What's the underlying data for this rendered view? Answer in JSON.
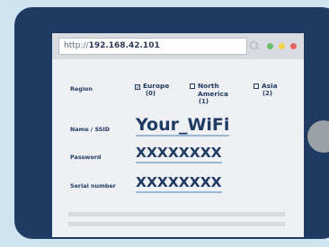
{
  "browser": {
    "url_prefix": "http://",
    "url_host": "192.168.42.101"
  },
  "form": {
    "region_label": "Region",
    "regions": [
      {
        "name": "Europe",
        "count": "(0)",
        "checked": true
      },
      {
        "name": "North America",
        "count": "(1)",
        "checked": false
      },
      {
        "name": "Asia",
        "count": "(2)",
        "checked": false
      }
    ],
    "ssid_label": "Name / SSID",
    "ssid_value": "Your_WiFi",
    "password_label": "Password",
    "password_value": "XXXXXXXX",
    "serial_label": "Serial number",
    "serial_value": "XXXXXXXX"
  },
  "colors": {
    "frame": "#1f3a63",
    "background": "#cfe4f1",
    "screen": "#eef0f3",
    "underline": "#9ab7cf"
  }
}
